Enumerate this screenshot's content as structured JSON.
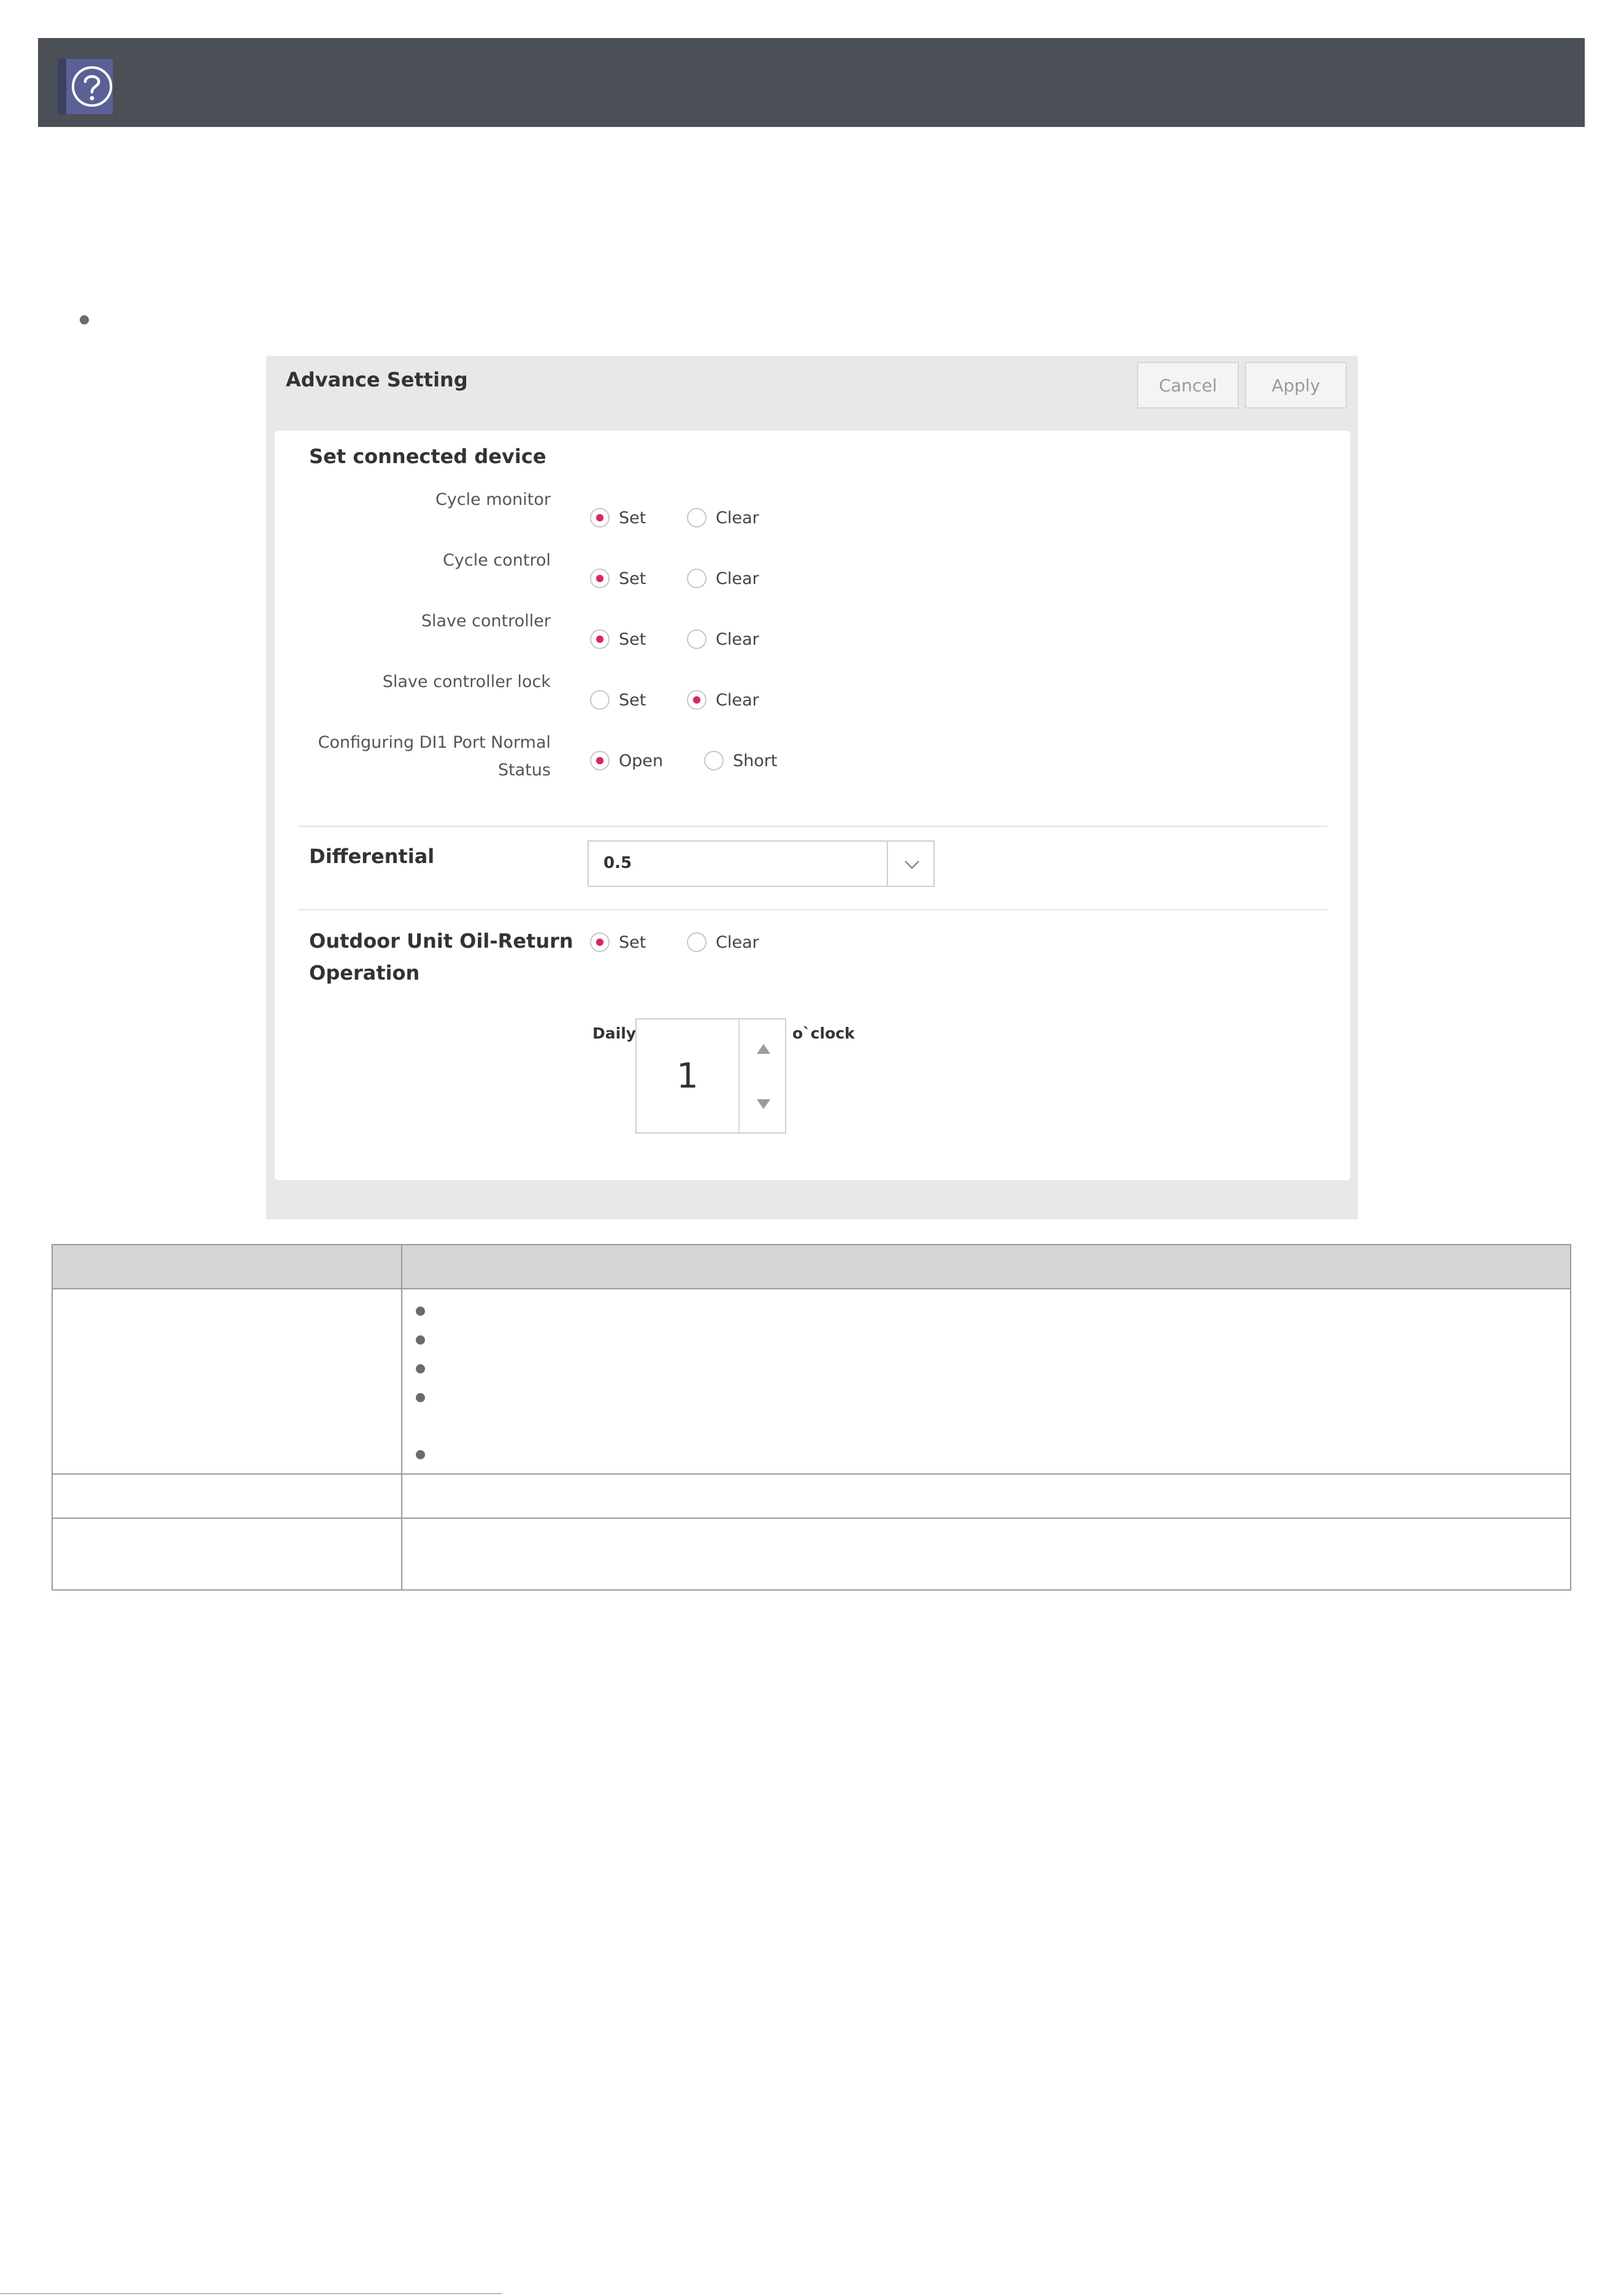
{
  "header": {
    "help_icon": "question-circle-icon",
    "bar_color": "#4b4f56"
  },
  "dialog": {
    "title": "Advance Setting",
    "cancel_label": "Cancel",
    "apply_label": "Apply",
    "set_connected_device": {
      "title": "Set connected device",
      "rows": [
        {
          "label": "Cycle monitor",
          "option1": "Set",
          "option2": "Clear",
          "selected": "Set"
        },
        {
          "label": "Cycle control",
          "option1": "Set",
          "option2": "Clear",
          "selected": "Set"
        },
        {
          "label": "Slave controller",
          "option1": "Set",
          "option2": "Clear",
          "selected": "Set"
        },
        {
          "label": "Slave controller lock",
          "option1": "Set",
          "option2": "Clear",
          "selected": "Clear"
        },
        {
          "label_line1": "Configuring DI1 Port Normal",
          "label_line2": "Status",
          "option1": "Open",
          "option2": "Short",
          "selected": "Open"
        }
      ]
    },
    "differential": {
      "title": "Differential",
      "value": "0.5"
    },
    "oil_return": {
      "title_line1": "Outdoor Unit Oil-Return",
      "title_line2": "Operation",
      "option1": "Set",
      "option2": "Clear",
      "selected": "Set",
      "daily_label": "Daily",
      "hour_value": "1",
      "oclock_label": "o`clock"
    },
    "accent_color": "#e0245e"
  }
}
